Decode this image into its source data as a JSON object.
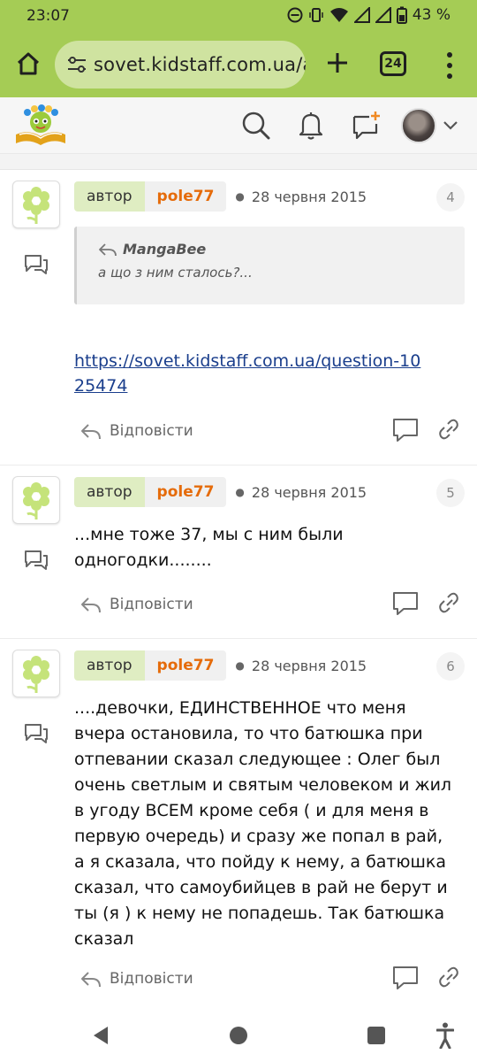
{
  "status_bar": {
    "time": "23:07",
    "battery": "43 %"
  },
  "browser": {
    "url": "sovet.kidstaff.com.ua/ar",
    "tab_count": "24"
  },
  "site_header": {
    "logo_icon": "kidstaff-logo",
    "search_icon": "search-icon",
    "bell_icon": "bell-icon",
    "new_post_icon": "new-message-icon"
  },
  "posts": [
    {
      "author_badge": "автор",
      "username": "pole77",
      "date": "28 червня 2015",
      "number": "4",
      "quote": {
        "author": "MangaBee",
        "text": "а що з ним сталось?..."
      },
      "link": "https://sovet.kidstaff.com.ua/question-1025474",
      "reply_label": "Відповісти"
    },
    {
      "author_badge": "автор",
      "username": "pole77",
      "date": "28 червня 2015",
      "number": "5",
      "text": "...мне тоже 37, мы с ним были одногодки........",
      "reply_label": "Відповісти"
    },
    {
      "author_badge": "автор",
      "username": "pole77",
      "date": "28 червня 2015",
      "number": "6",
      "text": "....девочки, ЕДИНСТВЕННОЕ что меня вчера остановила, то что батюшка при отпевании сказал следующее : Олег был очень светлым и святым человеком и жил в угоду ВСЕМ кроме себя ( и для меня в первую очередь) и сразу же попал в рай, а я сказала, что пойду к нему, а батюшка сказал, что самоубийцев в рай не берут и ты (я ) к нему не попадешь. Так батюшка сказал",
      "reply_label": "Відповісти"
    }
  ],
  "colors": {
    "browser_bar": "#a5cc55",
    "username": "#e56b0a",
    "author_badge": "#dfedc2",
    "link": "#1a3e8c"
  }
}
